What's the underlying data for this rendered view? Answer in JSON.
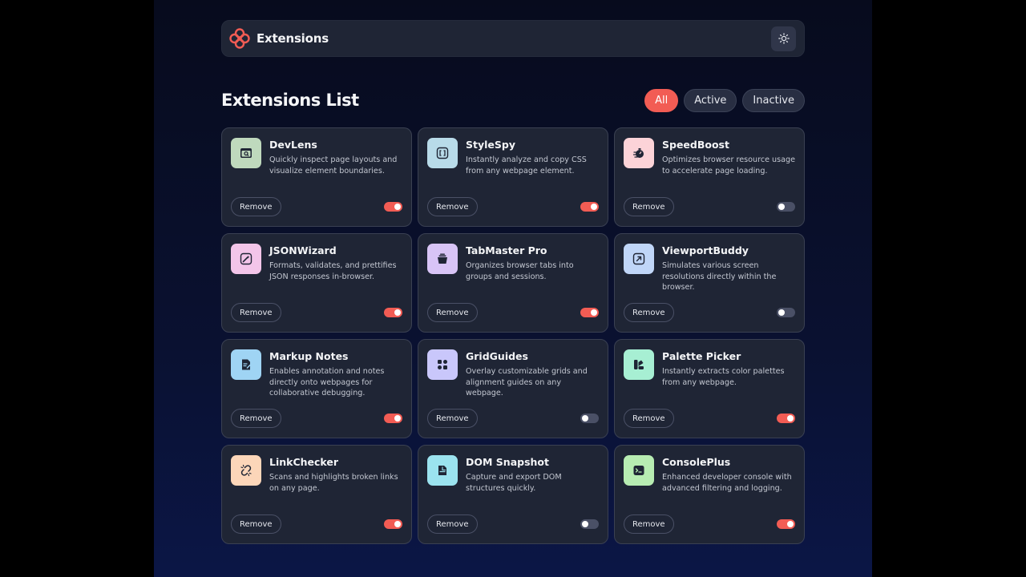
{
  "header": {
    "app_name": "Extensions",
    "theme_icon": "sun-icon"
  },
  "list": {
    "title": "Extensions List"
  },
  "filters": [
    {
      "label": "All",
      "selected": true
    },
    {
      "label": "Active",
      "selected": false
    },
    {
      "label": "Inactive",
      "selected": false
    }
  ],
  "remove_label": "Remove",
  "colors": {
    "accent": "#f25c54",
    "card": "#1f2535",
    "border": "#3a4052"
  },
  "extensions": [
    {
      "name": "DevLens",
      "description": "Quickly inspect page layouts and visualize element boundaries.",
      "active": true,
      "icon": "inspect-window-icon",
      "icon_bg": "#bfd9bd"
    },
    {
      "name": "StyleSpy",
      "description": "Instantly analyze and copy CSS from any webpage element.",
      "active": true,
      "icon": "code-brackets-icon",
      "icon_bg": "#b8dbe9"
    },
    {
      "name": "SpeedBoost",
      "description": "Optimizes browser resource usage to accelerate page loading.",
      "active": false,
      "icon": "speed-icon",
      "icon_bg": "#fcd3d8"
    },
    {
      "name": "JSONWizard",
      "description": "Formats, validates, and prettifies JSON responses in-browser.",
      "active": true,
      "icon": "wand-icon",
      "icon_bg": "#f3c5e9"
    },
    {
      "name": "TabMaster Pro",
      "description": "Organizes browser tabs into groups and sessions.",
      "active": true,
      "icon": "tabs-icon",
      "icon_bg": "#d8c4f6"
    },
    {
      "name": "ViewportBuddy",
      "description": "Simulates various screen resolutions directly within the browser.",
      "active": false,
      "icon": "resize-icon",
      "icon_bg": "#c0d6f8"
    },
    {
      "name": "Markup Notes",
      "description": "Enables annotation and notes directly onto webpages for collaborative debugging.",
      "active": true,
      "icon": "note-icon",
      "icon_bg": "#9fd4f4"
    },
    {
      "name": "GridGuides",
      "description": "Overlay customizable grids and alignment guides on any webpage.",
      "active": false,
      "icon": "grid-icon",
      "icon_bg": "#c9c7fb"
    },
    {
      "name": "Palette Picker",
      "description": "Instantly extracts color palettes from any webpage.",
      "active": true,
      "icon": "palette-icon",
      "icon_bg": "#a7efd3"
    },
    {
      "name": "LinkChecker",
      "description": "Scans and highlights broken links on any page.",
      "active": true,
      "icon": "broken-link-icon",
      "icon_bg": "#fcd6b9"
    },
    {
      "name": "DOM Snapshot",
      "description": "Capture and export DOM structures quickly.",
      "active": false,
      "icon": "snapshot-icon",
      "icon_bg": "#9be3ef"
    },
    {
      "name": "ConsolePlus",
      "description": "Enhanced developer console with advanced filtering and logging.",
      "active": true,
      "icon": "terminal-icon",
      "icon_bg": "#b7ecb2"
    }
  ]
}
